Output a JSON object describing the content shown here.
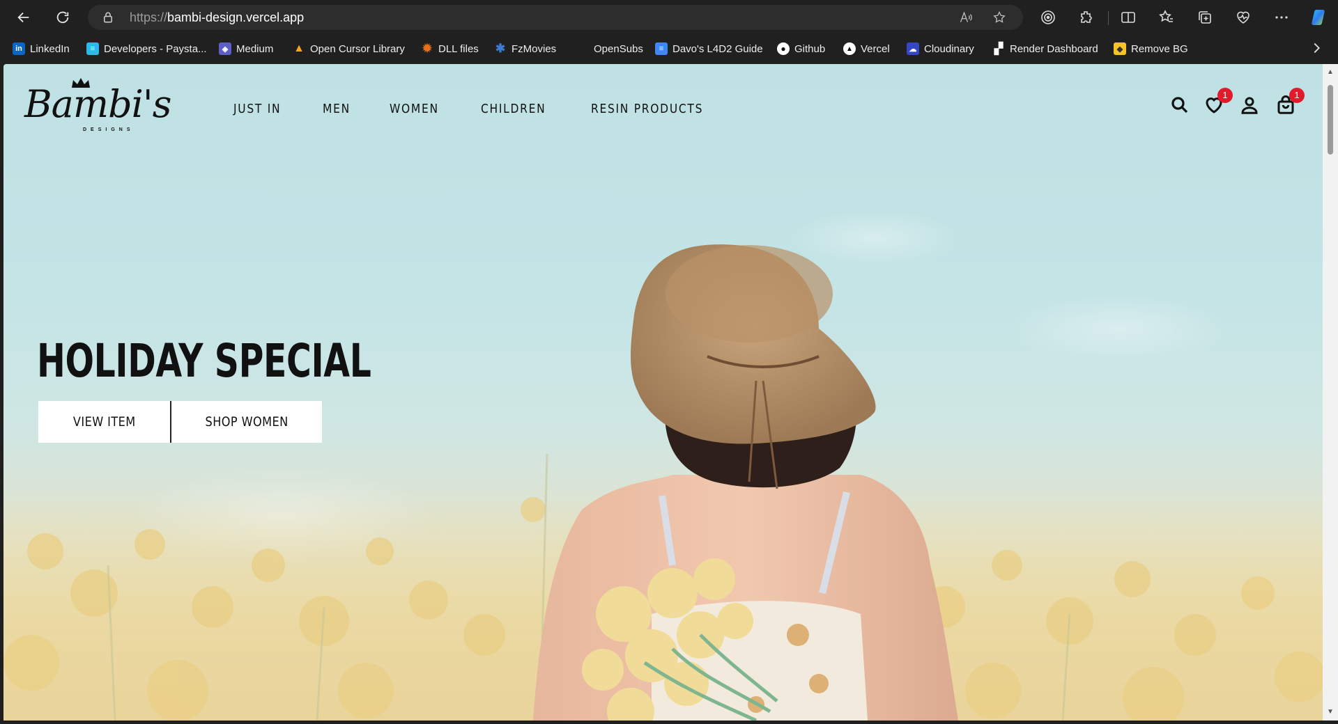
{
  "browser": {
    "url_scheme": "https://",
    "url_host": "bambi-design.vercel.app",
    "bookmarks": [
      {
        "label": "LinkedIn",
        "icon": "linkedin-icon",
        "color": "#0a66c2",
        "glyph": "in"
      },
      {
        "label": "Developers - Paysta...",
        "icon": "paystack-icon",
        "color": "#2eb8e6",
        "glyph": "≡"
      },
      {
        "label": "Medium",
        "icon": "medium-icon",
        "color": "#5b5fc7",
        "glyph": "◈"
      },
      {
        "label": "Open Cursor Library",
        "icon": "cursor-library-icon",
        "color": "#f5a623",
        "glyph": "▲"
      },
      {
        "label": "DLL files",
        "icon": "dll-files-icon",
        "color": "#e8701a",
        "glyph": "✹"
      },
      {
        "label": "FzMovies",
        "icon": "fzmovies-icon",
        "color": "#3a7bd5",
        "glyph": "✱"
      },
      {
        "label": "OpenSubs",
        "icon": "opensubs-icon",
        "color": "transparent",
        "glyph": ""
      },
      {
        "label": "Davo's L4D2 Guide",
        "icon": "google-docs-icon",
        "color": "#4285f4",
        "glyph": "≡"
      },
      {
        "label": "Github",
        "icon": "github-icon",
        "color": "#ffffff",
        "glyph": "●"
      },
      {
        "label": "Vercel",
        "icon": "vercel-icon",
        "color": "#000000",
        "glyph": "▲"
      },
      {
        "label": "Cloudinary",
        "icon": "cloudinary-icon",
        "color": "#3448c5",
        "glyph": "☁"
      },
      {
        "label": "Render Dashboard",
        "icon": "render-icon",
        "color": "#ffffff",
        "glyph": "▞"
      },
      {
        "label": "Remove BG",
        "icon": "remove-bg-icon",
        "color": "#f7c325",
        "glyph": "◆"
      }
    ]
  },
  "site": {
    "logo_text": "Bambi's",
    "logo_sub": "DESIGNS",
    "nav": [
      "JUST IN",
      "MEN",
      "WOMEN",
      "CHILDREN",
      "RESIN PRODUCTS"
    ],
    "wishlist_count": "1",
    "cart_count": "1"
  },
  "hero": {
    "title": "HOLIDAY SPECIAL",
    "buttons": [
      "VIEW ITEM",
      "SHOP WOMEN"
    ]
  }
}
